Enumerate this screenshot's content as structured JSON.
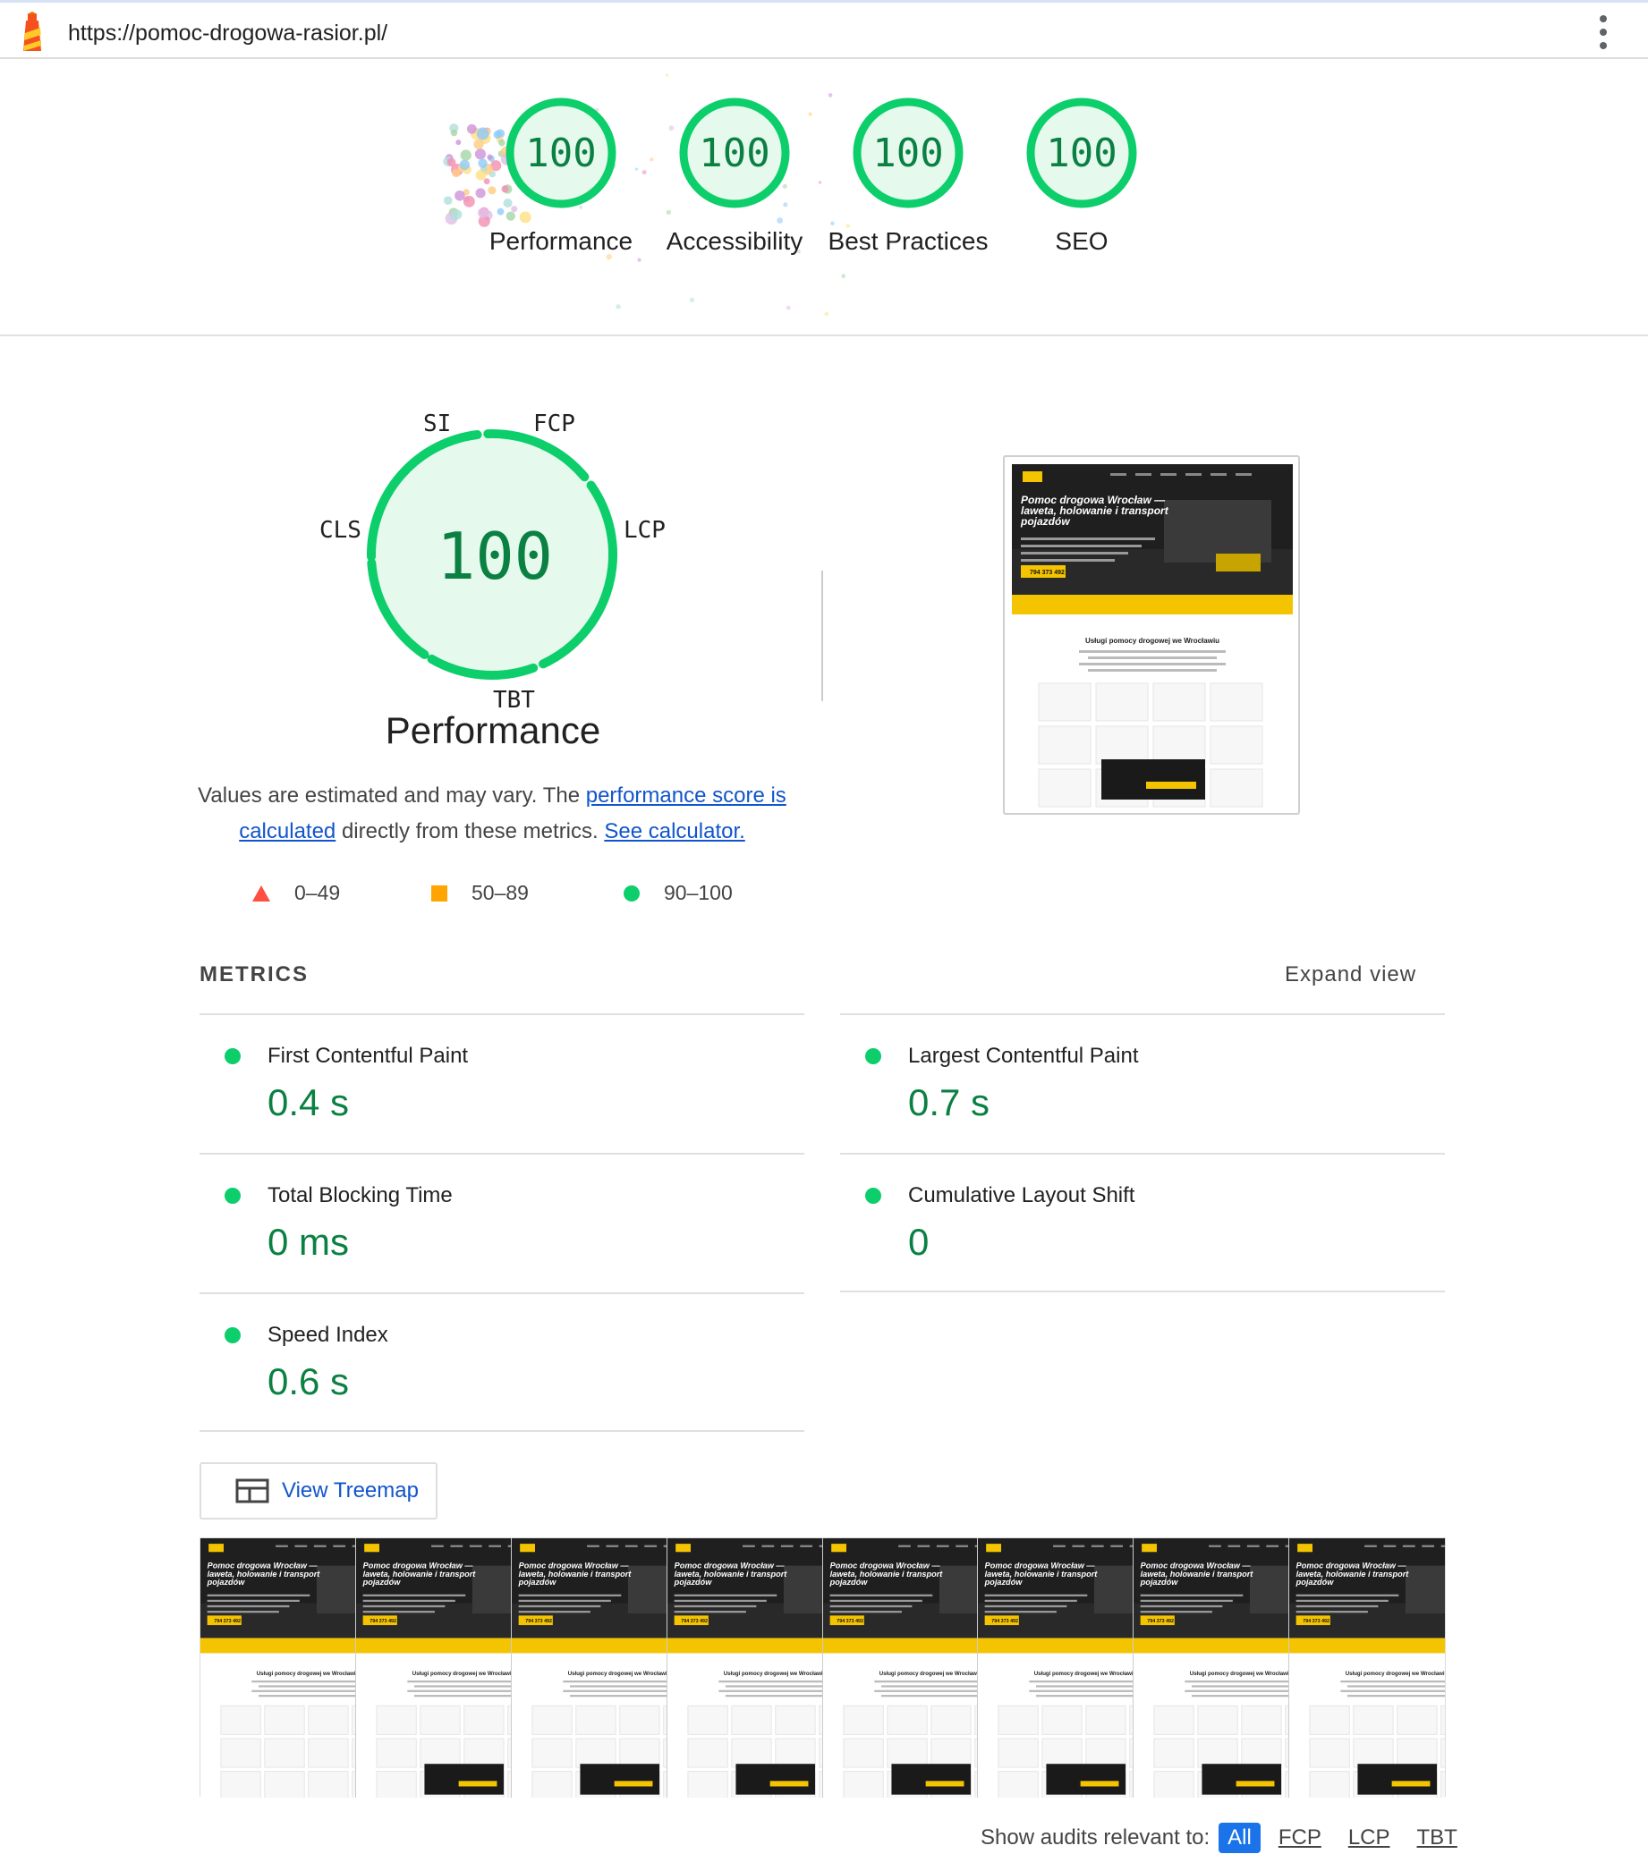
{
  "topbar": {
    "url": "https://pomoc-drogowa-rasior.pl/",
    "menu_icon": "more-vert-icon"
  },
  "colors": {
    "pass_green": "#0cce6b",
    "pass_text": "#0b8043",
    "pass_fill": "#e6f9ed",
    "fail_red": "#ff4e42",
    "average_orange": "#ffa400",
    "link_blue": "#1155cc",
    "chip_blue": "#1a73e8"
  },
  "category_gauges": [
    {
      "score": "100",
      "label": "Performance"
    },
    {
      "score": "100",
      "label": "Accessibility"
    },
    {
      "score": "100",
      "label": "Best Practices"
    },
    {
      "score": "100",
      "label": "SEO"
    }
  ],
  "performance": {
    "score": "100",
    "title": "Performance",
    "arc_labels": {
      "si": "SI",
      "fcp": "FCP",
      "lcp": "LCP",
      "tbt": "TBT",
      "cls": "CLS"
    },
    "note_prefix": "Values are estimated and may vary. The ",
    "note_link1": "performance score is calculated",
    "note_mid": " directly from these metrics. ",
    "note_link2": "See calculator.",
    "legend": [
      {
        "range": "0–49",
        "shape": "triangle"
      },
      {
        "range": "50–89",
        "shape": "square"
      },
      {
        "range": "90–100",
        "shape": "circle"
      }
    ]
  },
  "screenshot": {
    "headline": "Pomoc drogowa Wrocław — laweta, holowanie i transport pojazdów",
    "phone": "794 373 492",
    "section_title": "Usługi pomocy drogowej we Wrocławiu"
  },
  "metrics": {
    "heading": "METRICS",
    "expand_label": "Expand view",
    "items": [
      {
        "title": "First Contentful Paint",
        "value": "0.4 s"
      },
      {
        "title": "Largest Contentful Paint",
        "value": "0.7 s"
      },
      {
        "title": "Total Blocking Time",
        "value": "0 ms"
      },
      {
        "title": "Cumulative Layout Shift",
        "value": "0"
      },
      {
        "title": "Speed Index",
        "value": "0.6 s"
      }
    ]
  },
  "treemap_button": {
    "label": "View Treemap",
    "icon": "treemap-icon"
  },
  "filmstrip": {
    "frame_count": 8
  },
  "audit_filter": {
    "label": "Show audits relevant to:",
    "chips": [
      "All",
      "FCP",
      "LCP",
      "TBT"
    ],
    "active": "All"
  }
}
